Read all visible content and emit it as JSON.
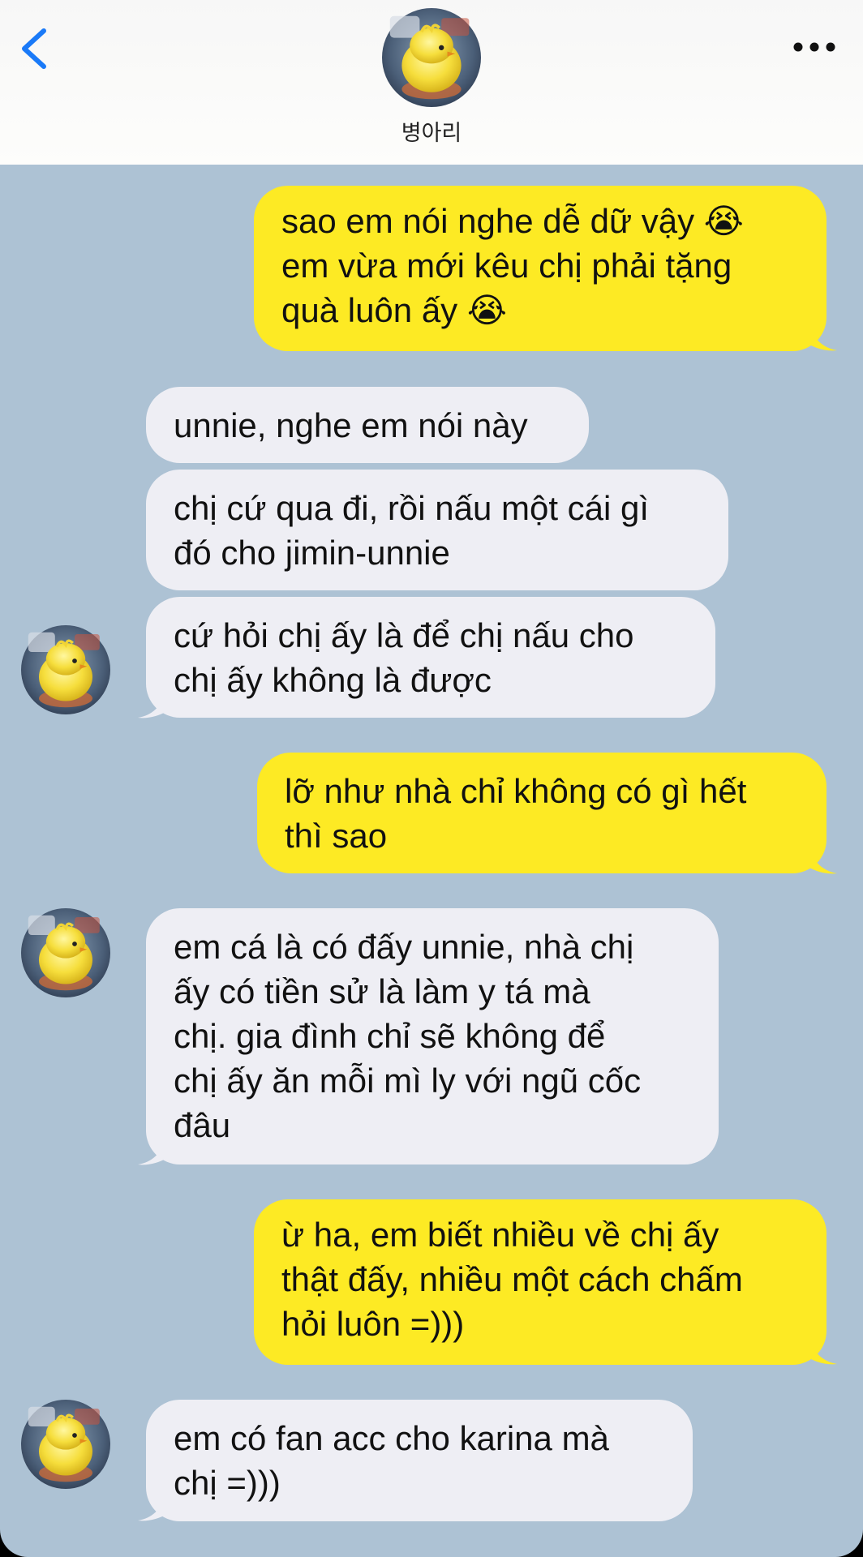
{
  "header": {
    "back_icon": "chevron-left-icon",
    "more_icon": "ellipsis-icon",
    "contact_name": "병아리",
    "avatar": "chick-avatar"
  },
  "colors": {
    "chat_background": "#adc2d4",
    "outgoing_bubble": "#fdea24",
    "incoming_bubble": "#eeeef4",
    "accent_blue": "#1a7af8"
  },
  "messages": [
    {
      "direction": "out",
      "text": "sao em nói nghe dễ dữ vậy 😭\nem vừa mới kêu chị phải tặng\nquà luôn ấy 😭"
    },
    {
      "direction": "in",
      "text": "unnie, nghe em nói này"
    },
    {
      "direction": "in",
      "text": "chị cứ qua đi, rồi nấu một cái gì\nđó cho jimin-unnie"
    },
    {
      "direction": "in",
      "text": "cứ hỏi chị ấy là để chị nấu cho\nchị ấy không là được"
    },
    {
      "direction": "out",
      "text": "lỡ như nhà chỉ không có gì hết\nthì sao"
    },
    {
      "direction": "in",
      "text": "em cá là có đấy unnie, nhà chị\nấy có tiền sử là làm y tá mà\nchị. gia đình chỉ sẽ không để\nchị ấy ăn mỗi mì ly với ngũ cốc\nđâu"
    },
    {
      "direction": "out",
      "text": "ừ ha, em biết nhiều về chị ấy\nthật đấy, nhiều một cách chấm\nhỏi luôn =)))"
    },
    {
      "direction": "in",
      "text": "em có fan acc cho karina mà\nchị =)))"
    }
  ]
}
